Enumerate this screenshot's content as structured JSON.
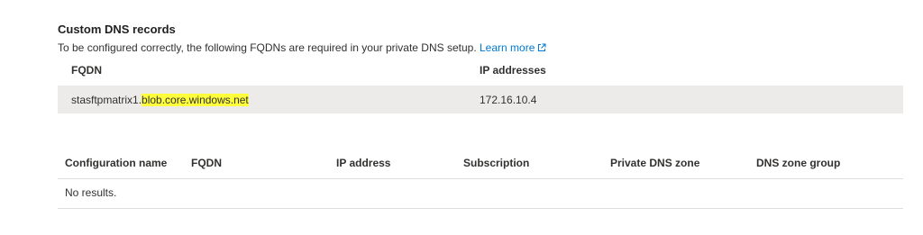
{
  "section": {
    "title": "Custom DNS records",
    "description": "To be configured correctly, the following FQDNs are required in your private DNS setup.",
    "learn_more": "Learn more"
  },
  "fqdn_table": {
    "columns": [
      "FQDN",
      "IP addresses"
    ],
    "rows": [
      {
        "fqdn_prefix": "stasftpmatrix1.",
        "fqdn_highlight": "blob.core.windows.net",
        "ip": "172.16.10.4"
      }
    ]
  },
  "config_table": {
    "columns": [
      "Configuration name",
      "FQDN",
      "IP address",
      "Subscription",
      "Private DNS zone",
      "DNS zone group"
    ],
    "empty_text": "No results."
  },
  "colors": {
    "link": "#0078d4",
    "row_background": "#edebe9",
    "highlight": "#ffff3b"
  }
}
